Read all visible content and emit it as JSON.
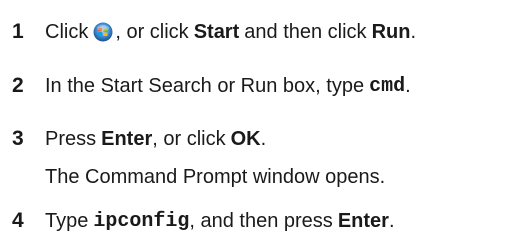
{
  "steps": [
    {
      "number": "1",
      "part1": "Click",
      "icon": "windows-start-orb-icon",
      "part2": ", or click",
      "bold1": "Start",
      "part3": "and then click",
      "bold2": "Run",
      "part4": "."
    },
    {
      "number": "2",
      "part1": "In the Start Search or Run box, type",
      "code": "cmd",
      "part2": "."
    },
    {
      "number": "3",
      "part1": "Press",
      "bold1": "Enter",
      "part2": ", or click",
      "bold2": "OK",
      "part3": ".",
      "note": "The Command Prompt window opens."
    },
    {
      "number": "4",
      "part1": "Type",
      "code": "ipconfig",
      "part2": ", and then press",
      "bold1": "Enter",
      "part3": "."
    }
  ]
}
